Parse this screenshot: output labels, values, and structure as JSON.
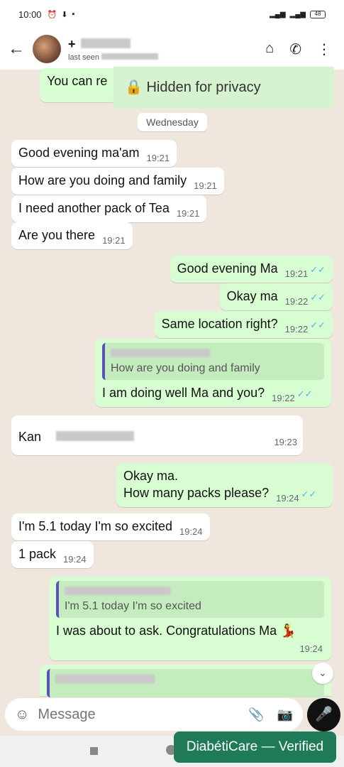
{
  "status": {
    "time": "10:00",
    "battery": "48"
  },
  "header": {
    "contact_name": "+",
    "last_seen": "last seen",
    "icons": [
      "back-arrow-icon",
      "label-icon",
      "add-call-icon",
      "more-vertical-icon"
    ]
  },
  "privacy_banner": "🔒 Hidden for privacy",
  "top_partial": "You can re",
  "day_chip": "Wednesday",
  "messages": [
    {
      "dir": "in",
      "text": "Good evening ma'am",
      "time": "19:21"
    },
    {
      "dir": "in",
      "text": "How are you doing and family",
      "time": "19:21"
    },
    {
      "dir": "in",
      "text": "I need another pack of Tea",
      "time": "19:21"
    },
    {
      "dir": "in",
      "text": "Are you there",
      "time": "19:21"
    },
    {
      "dir": "out",
      "text": "Good evening Ma",
      "time": "19:21"
    },
    {
      "dir": "out",
      "text": "Okay ma",
      "time": "19:22"
    },
    {
      "dir": "out",
      "text": "Same location right?",
      "time": "19:22"
    },
    {
      "dir": "out",
      "quote": "How are you doing and family",
      "text": "I am doing well Ma and you?",
      "time": "19:22"
    },
    {
      "dir": "in",
      "text": "Kan",
      "time": "19:23"
    },
    {
      "dir": "out",
      "text": "Okay ma.",
      "text2": "How many packs please?",
      "time": "19:24"
    },
    {
      "dir": "in",
      "text": "I'm 5.1 today I'm so excited",
      "time": "19:24"
    },
    {
      "dir": "in",
      "text": "1 pack",
      "time": "19:24"
    },
    {
      "dir": "out",
      "quote": "I'm 5.1 today I'm so excited",
      "text": "I was about to ask. Congratulations Ma 💃",
      "time": "19:24"
    }
  ],
  "input": {
    "placeholder": "Message"
  },
  "verified_badge": "DiabétiCare — Verified"
}
